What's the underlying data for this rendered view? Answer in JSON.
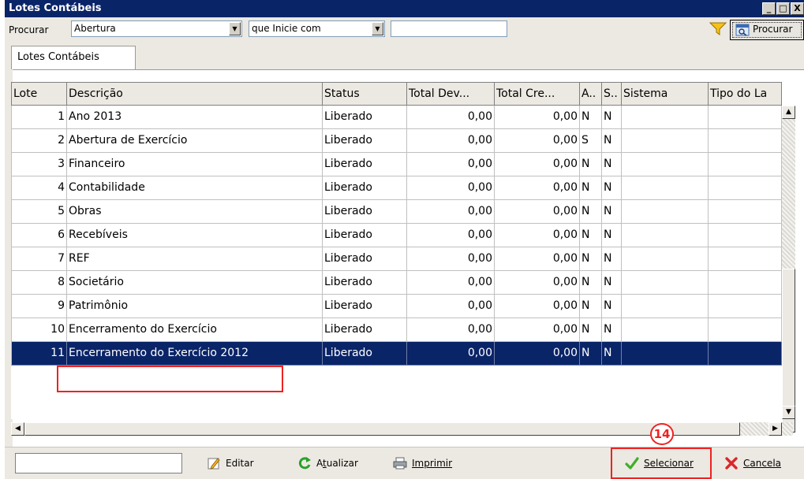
{
  "window": {
    "title": "Lotes Contábeis",
    "minimize_label": "_",
    "maximize_label": "□",
    "close_label": "X"
  },
  "search": {
    "label": "Procurar",
    "field_value": "Abertura",
    "mode_value": "que Inicie com",
    "query_value": "",
    "button_label": "Procurar"
  },
  "tabs": [
    {
      "label": "Lotes Contábeis"
    }
  ],
  "grid": {
    "columns": [
      "Lote",
      "Descrição",
      "Status",
      "Total Dev...",
      "Total Cre...",
      "A..",
      "S..",
      "Sistema",
      "Tipo do La"
    ],
    "rows": [
      [
        "1",
        "Ano 2013",
        "Liberado",
        "0,00",
        "0,00",
        "N",
        "N",
        "",
        ""
      ],
      [
        "2",
        "Abertura de Exercício",
        "Liberado",
        "0,00",
        "0,00",
        "S",
        "N",
        "",
        ""
      ],
      [
        "3",
        "Financeiro",
        "Liberado",
        "0,00",
        "0,00",
        "N",
        "N",
        "",
        ""
      ],
      [
        "4",
        "Contabilidade",
        "Liberado",
        "0,00",
        "0,00",
        "N",
        "N",
        "",
        ""
      ],
      [
        "5",
        "Obras",
        "Liberado",
        "0,00",
        "0,00",
        "N",
        "N",
        "",
        ""
      ],
      [
        "6",
        "Recebíveis",
        "Liberado",
        "0,00",
        "0,00",
        "N",
        "N",
        "",
        ""
      ],
      [
        "7",
        "REF",
        "Liberado",
        "0,00",
        "0,00",
        "N",
        "N",
        "",
        ""
      ],
      [
        "8",
        "Societário",
        "Liberado",
        "0,00",
        "0,00",
        "N",
        "N",
        "",
        ""
      ],
      [
        "9",
        "Patrimônio",
        "Liberado",
        "0,00",
        "0,00",
        "N",
        "N",
        "",
        ""
      ],
      [
        "10",
        "Encerramento do Exercício",
        "Liberado",
        "0,00",
        "0,00",
        "N",
        "N",
        "",
        ""
      ],
      [
        "11",
        "Encerramento do Exercício 2012",
        "Liberado",
        "0,00",
        "0,00",
        "N",
        "N",
        "",
        ""
      ]
    ],
    "selected_row": 10
  },
  "toolbar": {
    "status_value": "",
    "edit_label": "Editar",
    "edit_underline": "E",
    "refresh_label_pre": "A",
    "refresh_label_u": "t",
    "refresh_label_post": "ualizar",
    "print_label": "Imprimir",
    "select_label": "Selecionar",
    "cancel_label": "Cancela"
  },
  "annotation": {
    "step_number": "14"
  },
  "colors": {
    "titlebar": "#0a2468",
    "selection": "#0a2468",
    "highlight": "#e22222"
  }
}
